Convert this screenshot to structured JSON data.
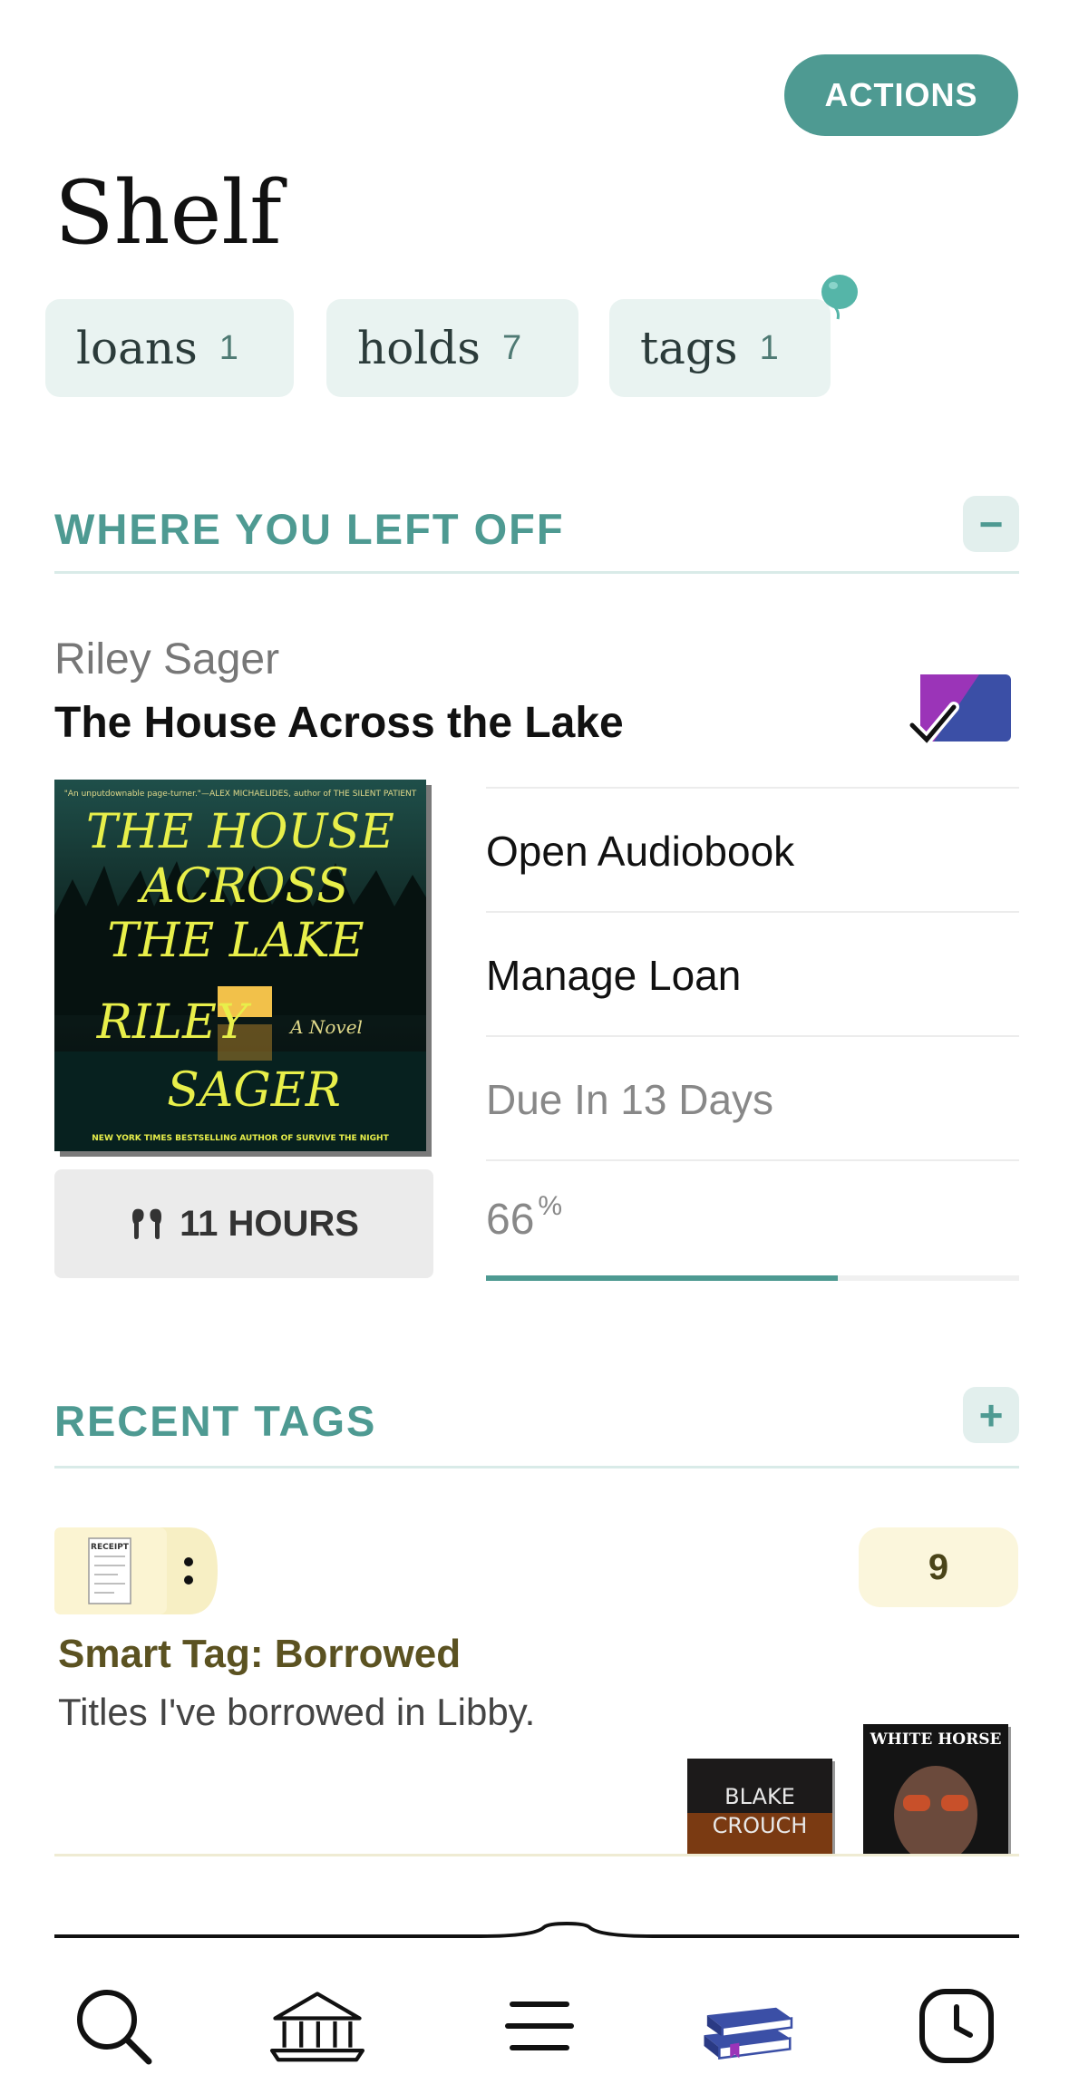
{
  "header": {
    "actions_label": "ACTIONS",
    "title": "Shelf"
  },
  "chips": [
    {
      "label": "loans",
      "count": "1"
    },
    {
      "label": "holds",
      "count": "7"
    },
    {
      "label": "tags",
      "count": "1"
    }
  ],
  "where_left_off": {
    "section_title": "WHERE YOU LEFT OFF",
    "toggle_label": "−",
    "author": "Riley Sager",
    "title": "The House Across the Lake",
    "format_icon": "audiobook-check-badge",
    "cover": {
      "blurb": "\"An unputdownable page-turner.\"—ALEX MICHAELIDES, author of THE SILENT PATIENT",
      "line1": "THE HOUSE",
      "line2": "ACROSS",
      "line3": "THE LAKE",
      "line4": "RILEY",
      "line5": "SAGER",
      "subtitle": "A Novel",
      "footer": "NEW YORK TIMES BESTSELLING AUTHOR OF SURVIVE THE NIGHT"
    },
    "duration_icon": "earbuds-icon",
    "duration_label": "11 HOURS",
    "actions": [
      {
        "label": "Open Audiobook"
      },
      {
        "label": "Manage Loan"
      }
    ],
    "due_label": "Due In 13 Days",
    "progress_value": "66",
    "progress_unit": "%",
    "progress_fraction": 0.66
  },
  "recent_tags": {
    "section_title": "RECENT TAGS",
    "toggle_label": "+",
    "tag": {
      "icon": "receipt-icon",
      "receipt_text": "RECEIPT",
      "count": "9",
      "name": "Smart Tag: Borrowed",
      "description": "Titles I've borrowed in Libby.",
      "covers": [
        {
          "line1": "BLAKE",
          "line2": "CROUCH"
        },
        {
          "title": "WHITE HORSE"
        }
      ]
    }
  },
  "nav": {
    "items": [
      "search-icon",
      "library-icon",
      "menu-icon",
      "shelf-icon",
      "timeline-icon"
    ],
    "active": "shelf-icon",
    "colors": {
      "active": "#3b4fa6",
      "accent": "#4e9a92"
    }
  }
}
